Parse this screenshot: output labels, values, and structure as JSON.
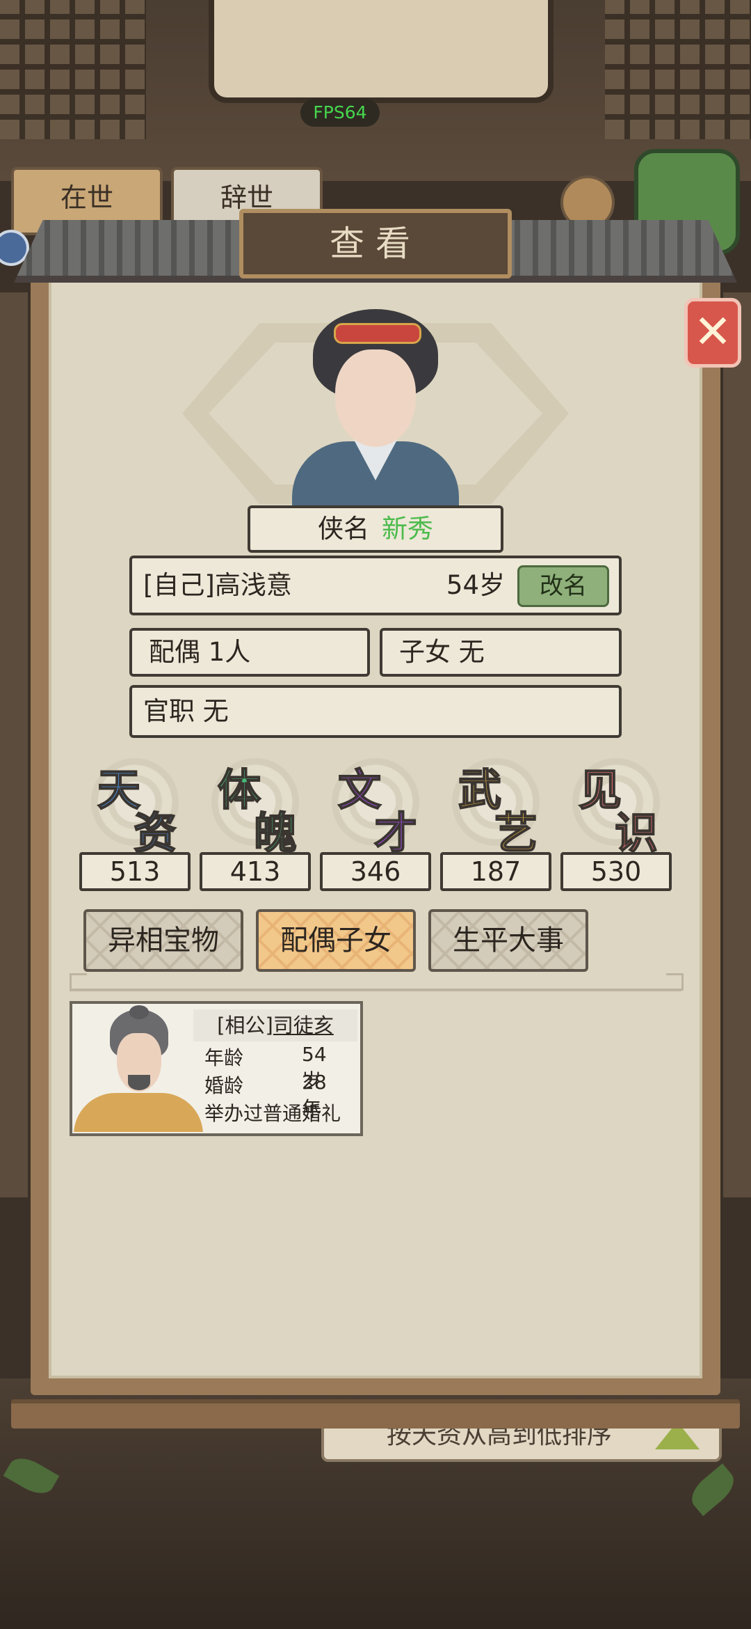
{
  "hud": {
    "fps": "FPS64"
  },
  "background": {
    "tab_alive": "在世",
    "tab_dead": "辞世",
    "sort_label": "按天资从高到低排序"
  },
  "dialog": {
    "title": "查看",
    "close_icon": "close-x-icon"
  },
  "profile": {
    "title_label": "侠名",
    "title_value": "新秀",
    "name": "[自己]高浅意",
    "age": "54岁",
    "rename_label": "改名",
    "spouse_label": "配偶",
    "spouse_value": "1人",
    "children_label": "子女",
    "children_value": "无",
    "office_label": "官职",
    "office_value": "无"
  },
  "stats": [
    {
      "char1": "天",
      "char2": "资",
      "value": "513",
      "color": "#4a8cd8"
    },
    {
      "char1": "体",
      "char2": "魄",
      "value": "413",
      "color": "#49b87a"
    },
    {
      "char1": "文",
      "char2": "才",
      "value": "346",
      "color": "#9a4ad0"
    },
    {
      "char1": "武",
      "char2": "艺",
      "value": "187",
      "color": "#e0b04a"
    },
    {
      "char1": "见",
      "char2": "识",
      "value": "530",
      "color": "#e07272"
    }
  ],
  "tabs": [
    {
      "label": "异相宝物",
      "active": false
    },
    {
      "label": "配偶子女",
      "active": true
    },
    {
      "label": "生平大事",
      "active": false
    }
  ],
  "spouse_card": {
    "relation": "[相公]",
    "name": "司徒亥",
    "age_label": "年龄",
    "age_value": "54岁",
    "marriage_label": "婚龄",
    "marriage_value": "28年",
    "ceremony": "举办过普通婚礼"
  }
}
